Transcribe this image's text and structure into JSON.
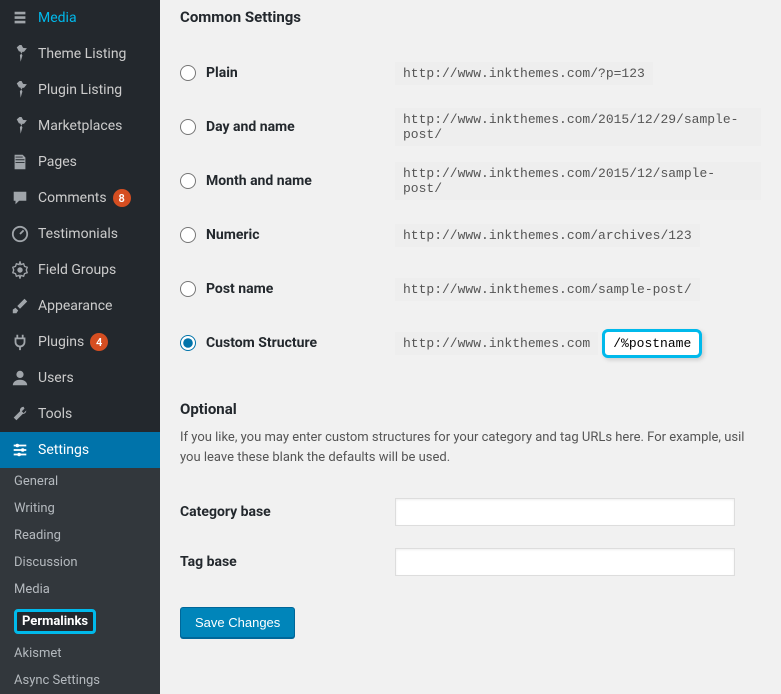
{
  "sidebar": {
    "items": [
      {
        "label": "Media",
        "icon": "media"
      },
      {
        "label": "Theme Listing",
        "icon": "pin"
      },
      {
        "label": "Plugin Listing",
        "icon": "pin"
      },
      {
        "label": "Marketplaces",
        "icon": "pin"
      },
      {
        "label": "Pages",
        "icon": "page"
      },
      {
        "label": "Comments",
        "icon": "comment",
        "badge": "8"
      },
      {
        "label": "Testimonials",
        "icon": "dash"
      },
      {
        "label": "Field Groups",
        "icon": "gear"
      },
      {
        "label": "Appearance",
        "icon": "brush"
      },
      {
        "label": "Plugins",
        "icon": "plug",
        "badge": "4"
      },
      {
        "label": "Users",
        "icon": "user"
      },
      {
        "label": "Tools",
        "icon": "wrench"
      },
      {
        "label": "Settings",
        "icon": "sliders"
      }
    ],
    "submenu": [
      {
        "label": "General"
      },
      {
        "label": "Writing"
      },
      {
        "label": "Reading"
      },
      {
        "label": "Discussion"
      },
      {
        "label": "Media"
      },
      {
        "label": "Permalinks",
        "highlight": true
      },
      {
        "label": "Akismet"
      },
      {
        "label": "Async Settings"
      }
    ]
  },
  "settings": {
    "heading_common": "Common Settings",
    "heading_optional": "Optional",
    "options": [
      {
        "label": "Plain",
        "url": "http://www.inkthemes.com/?p=123"
      },
      {
        "label": "Day and name",
        "url": "http://www.inkthemes.com/2015/12/29/sample-post/"
      },
      {
        "label": "Month and name",
        "url": "http://www.inkthemes.com/2015/12/sample-post/"
      },
      {
        "label": "Numeric",
        "url": "http://www.inkthemes.com/archives/123"
      },
      {
        "label": "Post name",
        "url": "http://www.inkthemes.com/sample-post/"
      }
    ],
    "custom_label": "Custom Structure",
    "custom_prefix": "http://www.inkthemes.com",
    "custom_value": "/%postname%/",
    "optional_desc": "If you like, you may enter custom structures for your category and tag URLs here. For example, usil you leave these blank the defaults will be used.",
    "category_base_label": "Category base",
    "tag_base_label": "Tag base",
    "save_label": "Save Changes"
  }
}
